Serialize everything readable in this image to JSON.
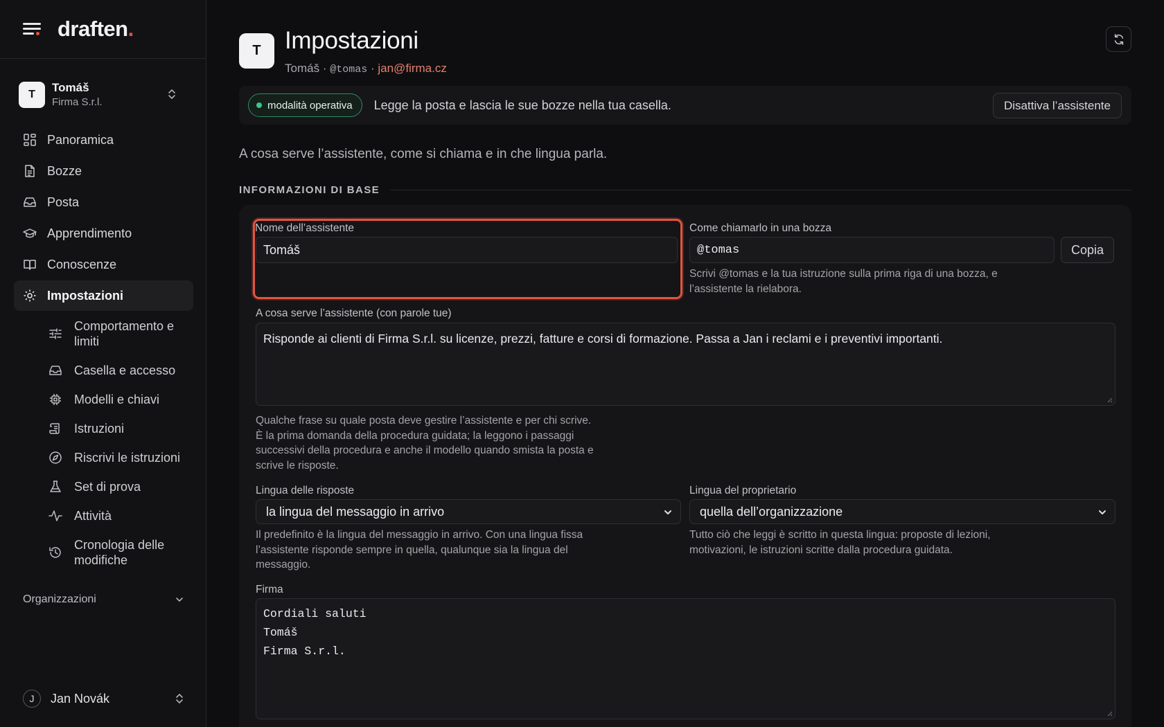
{
  "brand": {
    "name": "draften",
    "dot": "."
  },
  "account": {
    "initial": "T",
    "name": "Tomáš",
    "org": "Firma S.r.l."
  },
  "nav": [
    {
      "label": "Panoramica",
      "icon": "dashboard-icon"
    },
    {
      "label": "Bozze",
      "icon": "document-icon"
    },
    {
      "label": "Posta",
      "icon": "inbox-icon"
    },
    {
      "label": "Apprendimento",
      "icon": "graduation-cap-icon"
    },
    {
      "label": "Conoscenze",
      "icon": "book-icon"
    },
    {
      "label": "Impostazioni",
      "icon": "gear-icon",
      "active": true
    }
  ],
  "subnav": [
    {
      "label": "Comportamento e limiti",
      "icon": "sliders-icon"
    },
    {
      "label": "Casella e accesso",
      "icon": "inbox-icon"
    },
    {
      "label": "Modelli e chiavi",
      "icon": "chip-icon"
    },
    {
      "label": "Istruzioni",
      "icon": "scroll-icon"
    },
    {
      "label": "Riscrivi le istruzioni",
      "icon": "compass-icon"
    },
    {
      "label": "Set di prova",
      "icon": "flask-icon"
    },
    {
      "label": "Attività",
      "icon": "activity-icon"
    },
    {
      "label": "Cronologia delle modifiche",
      "icon": "history-icon"
    }
  ],
  "orgs_label": "Organizzazioni",
  "user": {
    "initial": "J",
    "name": "Jan Novák"
  },
  "header": {
    "initial": "T",
    "title": "Impostazioni",
    "name": "Tomáš",
    "sep": "·",
    "handle": "@tomas",
    "email": "jan@firma.cz"
  },
  "status": {
    "pill": "modalità operativa",
    "text": "Legge la posta e lascia le sue bozze nella tua casella.",
    "deactivate": "Disattiva l’assistente"
  },
  "intro": "A cosa serve l’assistente, come si chiama e in che lingua parla.",
  "section_title": "INFORMAZIONI DI BASE",
  "form": {
    "name_label": "Nome dell’assistente",
    "name_value": "Tomáš",
    "mention_label": "Come chiamarlo in una bozza",
    "mention_value": "@tomas",
    "copy": "Copia",
    "mention_help_1": "Scrivi @tomas e la tua istruzione sulla prima riga di una bozza, e",
    "mention_help_2": "l’assistente la rielabora.",
    "purpose_label": "A cosa serve l’assistente (con parole tue)",
    "purpose_value": "Risponde ai clienti di Firma S.r.l. su licenze, prezzi, fatture e corsi di formazione. Passa a Jan i reclami e i preventivi importanti.",
    "purpose_help": [
      "Qualche frase su quale posta deve gestire l’assistente e per chi scrive.",
      "È la prima domanda della procedura guidata; la leggono i passaggi",
      "successivi della procedura e anche il modello quando smista la posta e",
      "scrive le risposte."
    ],
    "reply_lang_label": "Lingua delle risposte",
    "reply_lang_value": "la lingua del messaggio in arrivo",
    "reply_lang_help": [
      "Il predefinito è la lingua del messaggio in arrivo. Con una lingua fissa",
      "l’assistente risponde sempre in quella, qualunque sia la lingua del",
      "messaggio."
    ],
    "owner_lang_label": "Lingua del proprietario",
    "owner_lang_value": "quella dell’organizzazione",
    "owner_lang_help": [
      "Tutto ciò che leggi è scritto in questa lingua: proposte di lezioni,",
      "motivazioni, le istruzioni scritte dalla procedura guidata."
    ],
    "signature_label": "Firma",
    "signature_lines": [
      "Cordiali saluti",
      "Tomáš",
      "Firma S.r.l."
    ]
  },
  "colors": {
    "accent": "#e5533d",
    "status_green": "#3cc48a",
    "email": "#e5806b"
  }
}
